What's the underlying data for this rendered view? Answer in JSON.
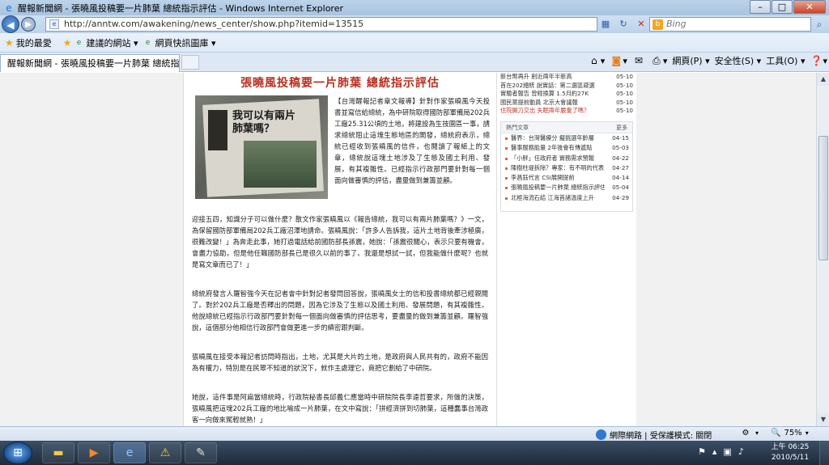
{
  "window": {
    "title": "醒報新聞網 - 張曉風投稿要一片肺葉 總統指示評估 - Windows Internet Explorer",
    "controls": {
      "minimize": "–",
      "maximize": "□",
      "close": "✕"
    }
  },
  "address": {
    "url": "http://anntw.com/awakening/news_center/show.php?itemid=13515",
    "search_placeholder": "Bing"
  },
  "favorites": {
    "label": "我的最愛",
    "items": [
      "建議的網站 ▾",
      "網頁快訊圖庫 ▾"
    ]
  },
  "tab": {
    "label": "醒報新聞網 - 張曉風投稿要一片肺葉 總統指示評估"
  },
  "commands": {
    "page": "網頁(P) ▾",
    "safety": "安全性(S) ▾",
    "tools": "工具(O) ▾"
  },
  "article": {
    "headline": "張曉風投稿要一片肺葉 總統指示評估",
    "photo_caption": "我可以有兩片肺葉嗎？",
    "lead": "【台灣醒報記者章文報導】針對作家張曉風今天投書並寫信給總統，為中研院取得國防部軍備局202兵工廠25.31公頃的土地，將建設為生技園區一事，請求總統阻止這塊生態地區的開發，總統府表示，總統已經收到張曉風的信件，也閱讀了報紙上的文章，總統說這塊土地涉及了生態及國土利用、發展，有其複雜性。已經指示行政部門要針對每一個面向做審慎的評估，盡量做到兼籌並顧。",
    "paragraphs": [
      "迎接五四，知識分子可以做什麼？散文作家張曉風以《報告總統，我可以有兩片肺葉嗎？》一文，為保留國防部軍備局202兵工廠沼澤地請命。張曉風說：「許多人告訴我，這片土地背後牽涉極廣，很難改變！」為奔走此事，她打過電話給前國防部長孫震，她說：「孫震很關心，表示只要有機會，會盡力協助，但是他任職國防部長已是很久以前的事了。我還是想試一試，但我能做什麼呢？也就是寫文章而已了！」",
      "總統府發言人羅智強今天在記者會中針對記者發問回答說，張曉風女士的信和投書總統都已經親閱了。對於202兵工廠是否釋出的問題，因為它涉及了生態以及國土利用、發展問題，有其複雜性。他說總統已經指示行政部門要針對每一個面向做審慎的評估思考，要盡量的做到兼籌並顧。羅智強說，這個部分他相信行政部門會做更進一步的縝密跟判斷。",
      "張曉風在接受本報記者訪問時指出，土地，尤其是大片的土地，是政府與人民共有的，政府不能因為有權力，特別是在民眾不知道的狀況下，就作主處理它，竟把它劃給了中研院。",
      "她說，這件事是阿扁當總統時，行政院秘書長邱義仁應當時中研院院長李遠哲要求，所做的決策，張曉風把這塊202兵工廠的地比喻成一片肺葉，在文中寫說：「拼經濟拼到切肺葉，這種蠢事台灣政客一向做來駕輕就熟！」"
    ]
  },
  "sidebar": {
    "top_list": [
      {
        "title": "新台幣再升 創近兩年半新高",
        "date": "05-10"
      },
      {
        "title": "首在202總統 說實話：第二選區避選",
        "date": "05-10"
      },
      {
        "title": "實驗者報告 曾經換算 1.5月約27K",
        "date": "05-10"
      },
      {
        "title": "國民黨提前動員 北京大會議報",
        "date": "05-10"
      },
      {
        "title": "住院開刀交出 失眠兩年嚴重了嗎？",
        "date": "05-10"
      }
    ],
    "panel": {
      "title": "熱門文章",
      "more": "更多",
      "items": [
        {
          "title": "醫界：台灣醫療分 擬挑選年齡層",
          "date": "04-15"
        },
        {
          "title": "醫事服務能量 2年後會有傳遞點",
          "date": "05-03"
        },
        {
          "title": "「小胖」任政府者 實務需求預報",
          "date": "04-22"
        },
        {
          "title": "陳樹柱堤拆除？專家：有不明的代表",
          "date": "04-27"
        },
        {
          "title": "李昌鈺代言 CSI展開提前",
          "date": "04-14"
        },
        {
          "title": "張曉風投稿要一片肺葉 總統指示評估",
          "date": "05-04"
        },
        {
          "title": "北極海流石結 江海首諸溫度上升",
          "date": "04-29"
        }
      ]
    }
  },
  "status": {
    "zone": "網際網路 | 受保護模式: 關閉",
    "zoom": "75%"
  },
  "taskbar": {
    "time": "上午 06:25",
    "date": "2010/5/11"
  }
}
